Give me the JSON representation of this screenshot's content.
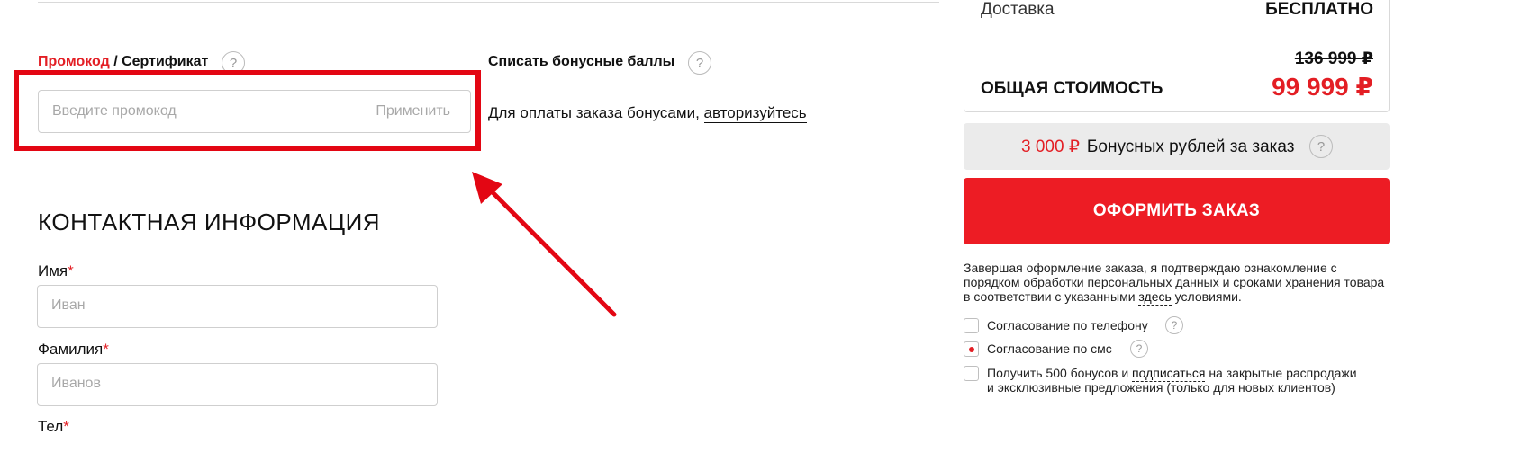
{
  "promo": {
    "promo_link": "Промокод",
    "separator": " / ",
    "certificate": "Сертификат",
    "help": "?",
    "placeholder": "Введите промокод",
    "apply": "Применить"
  },
  "bonus": {
    "title": "Списать бонусные баллы",
    "help": "?",
    "text": "Для оплаты заказа бонусами, ",
    "auth_link": "авторизуйтесь"
  },
  "contact": {
    "title": "КОНТАКТНАЯ ИНФОРМАЦИЯ",
    "first_name_label": "Имя",
    "first_name_placeholder": "Иван",
    "last_name_label": "Фамилия",
    "last_name_placeholder": "Иванов",
    "phone_label_partial": "Тел",
    "required_mark": "*"
  },
  "summary": {
    "delivery_label": "Доставка",
    "delivery_value": "БЕСПЛАТНО",
    "old_price": "136 999 ₽",
    "total_label": "ОБЩАЯ СТОИМОСТЬ",
    "total_value": "99 999 ₽",
    "bonus_amount": "3 000 ₽",
    "bonus_text": "Бонусных рублей за заказ",
    "help": "?"
  },
  "order_button": "ОФОРМИТЬ ЗАКАЗ",
  "agreement": {
    "text_before": "Завершая оформление заказа, я подтверждаю ознакомление с порядком обработки персональных данных и сроками хранения товара в соответствии с указанными ",
    "link": "здесь",
    "text_after": " условиями."
  },
  "options": [
    {
      "label": "Согласование по телефону",
      "checked": false
    },
    {
      "label": "Согласование по смс",
      "checked": true
    },
    {
      "label_before": "Получить 500 бонусов и ",
      "link": "подписаться",
      "label_after": " на закрытые распродажи и эксклюзивные предложения (только для новых клиентов)",
      "checked": false
    }
  ],
  "colors": {
    "accent": "#ed1c24",
    "annotation": "#e30613"
  }
}
